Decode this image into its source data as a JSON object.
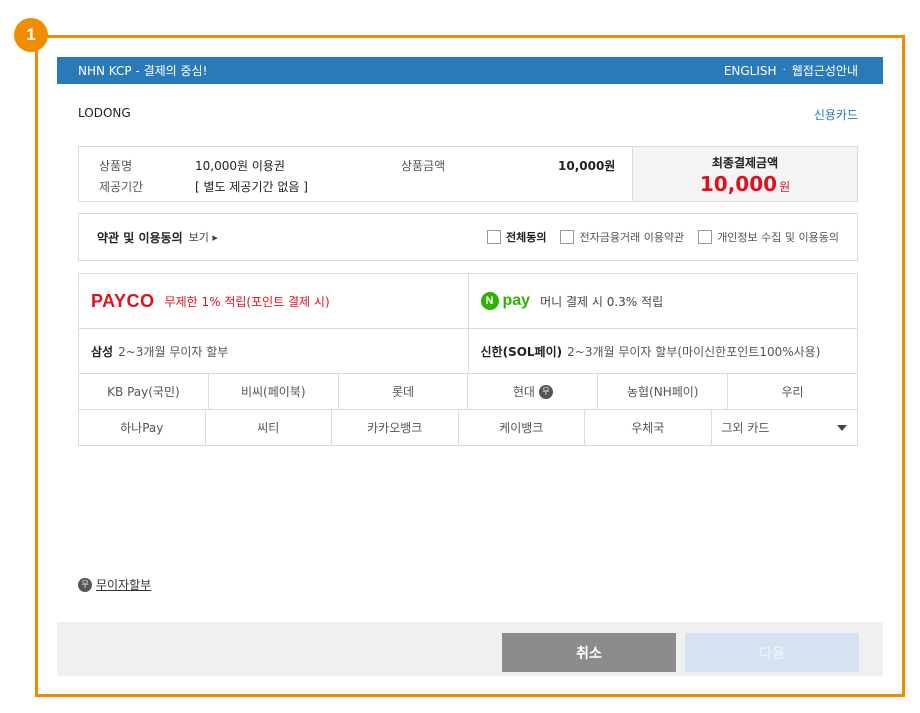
{
  "step_badge": "1",
  "header": {
    "title": "NHN KCP - 결제의 중심!",
    "english_link": "ENGLISH",
    "separator": "·",
    "accessibility_link": "웹접근성안내"
  },
  "merchant_name": "LODONG",
  "payment_method": "신용카드",
  "summary": {
    "product_name_label": "상품명",
    "product_name": "10,000원 이용권",
    "period_label": "제공기간",
    "period": "[ 별도 제공기간 없음 ]",
    "price_label": "상품금액",
    "price": "10,000원",
    "total_label": "최종결제금액",
    "total_amount": "10,000",
    "total_unit": "원"
  },
  "terms": {
    "title": "약관 및 이용동의",
    "view_label": "보기 ▸",
    "agree_all": "전체동의",
    "agree_finance": "전자금융거래 이용약관",
    "agree_privacy": "개인정보 수집 및 이용동의"
  },
  "promotions": {
    "payco_logo": "PAYCO",
    "payco_text": "무제한 1% 적립(포인트 결제 시)",
    "npay_logo_n": "N",
    "npay_logo": "pay",
    "npay_text": "머니 결제 시 0.3% 적립"
  },
  "bank_promos": {
    "samsung_name": "삼성",
    "samsung_text": "2~3개월 무이자 할부",
    "shinhan_name": "신한(SOL페이)",
    "shinhan_text": "2~3개월 무이자 할부(마이신한포인트100%사용)"
  },
  "card_grid": {
    "row1": [
      "KB Pay(국민)",
      "비씨(페이북)",
      "롯데",
      "현대",
      "농협(NH페이)",
      "우리"
    ],
    "row2": [
      "하나Pay",
      "씨티",
      "카카오뱅크",
      "케이뱅크",
      "우체국"
    ],
    "other_cards": "그외 카드",
    "mu_icon": "무"
  },
  "installment_link": "무이자할부",
  "buttons": {
    "cancel": "취소",
    "next": "다음"
  },
  "colors": {
    "accent_orange": "#f08c00",
    "header_blue": "#2a7ab7",
    "price_red": "#e0101f",
    "npay_green": "#2db400"
  }
}
